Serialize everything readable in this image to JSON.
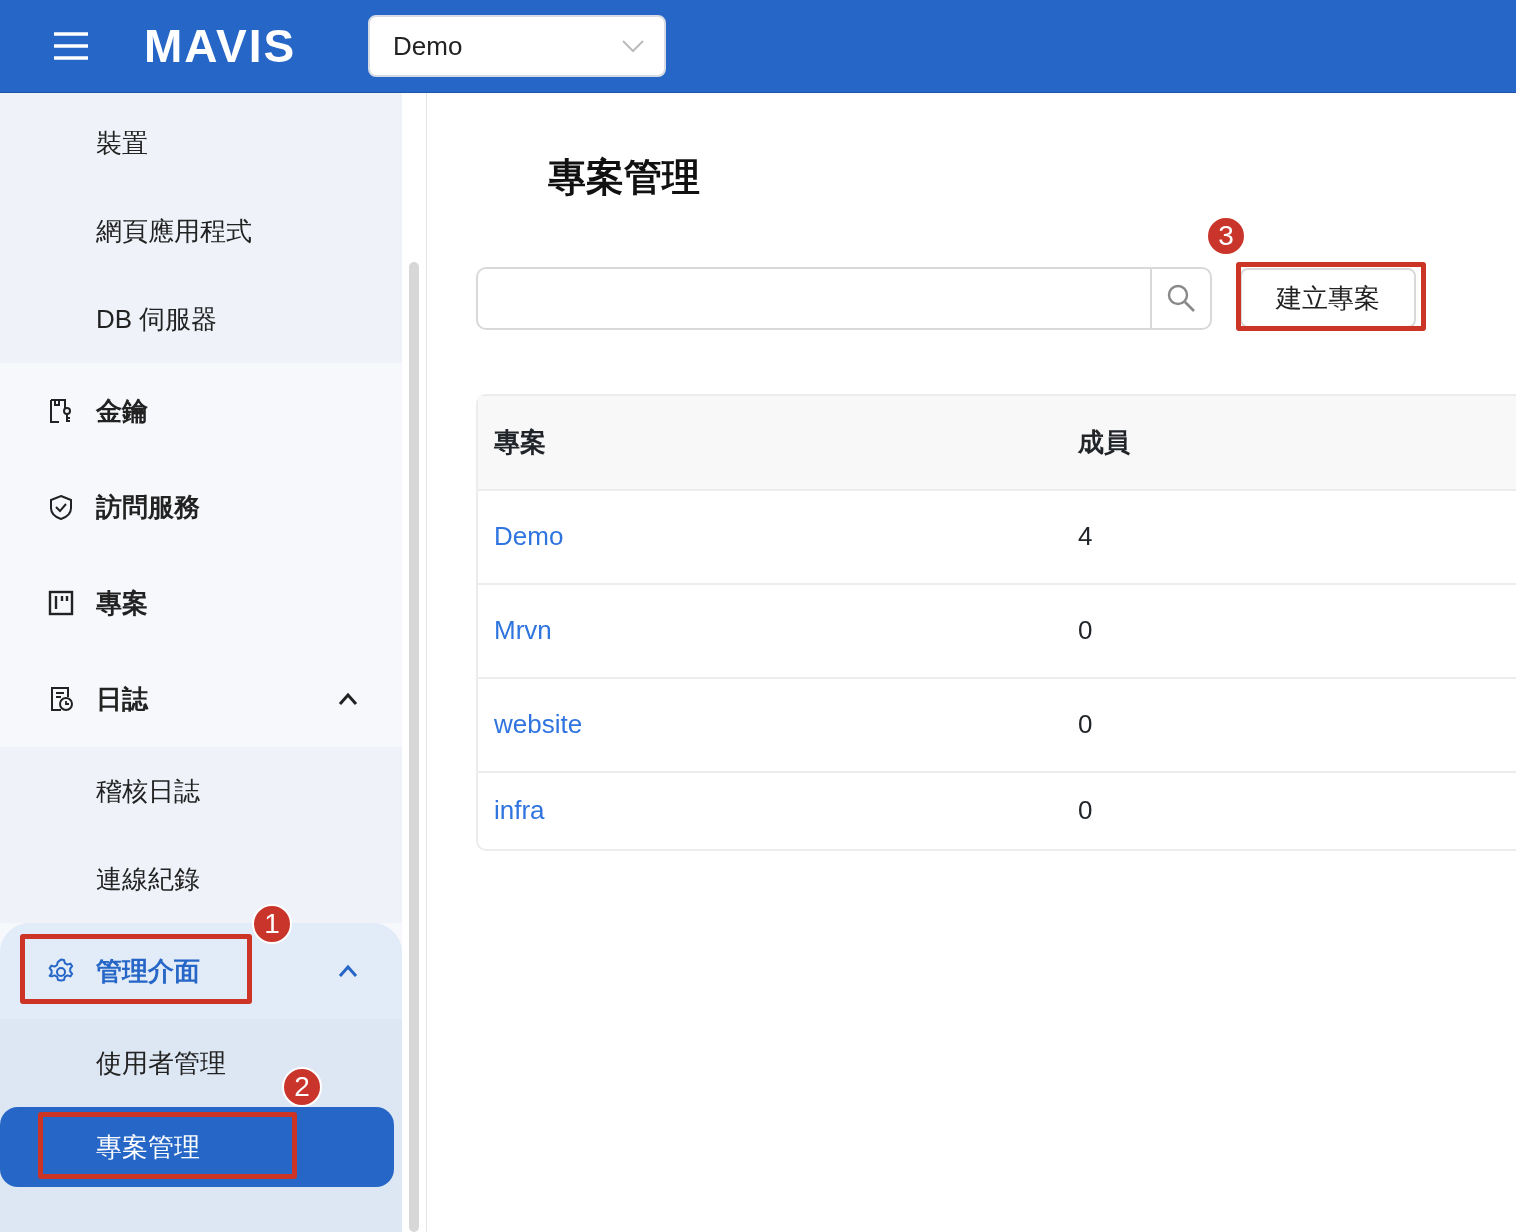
{
  "topbar": {
    "logo": "MAVIS",
    "project_select": {
      "value": "Demo"
    }
  },
  "sidebar": {
    "top_children": [
      {
        "label": "裝置",
        "selected": false
      },
      {
        "label": "網頁應用程式",
        "selected": false
      },
      {
        "label": "DB 伺服器",
        "selected": false
      }
    ],
    "items": [
      {
        "label": "金鑰",
        "kind": "key",
        "active": false
      },
      {
        "label": "訪問服務",
        "kind": "shield",
        "active": false
      },
      {
        "label": "專案",
        "kind": "board",
        "active": false
      },
      {
        "label": "日誌",
        "kind": "log",
        "active": false,
        "expanded": true,
        "children": [
          {
            "label": "稽核日誌",
            "selected": false
          },
          {
            "label": "連線紀錄",
            "selected": false
          }
        ]
      },
      {
        "label": "管理介面",
        "kind": "gear",
        "active": true,
        "expanded": true,
        "callout": "1",
        "children": [
          {
            "label": "使用者管理",
            "selected": false
          },
          {
            "label": "專案管理",
            "selected": true,
            "callout": "2"
          }
        ]
      }
    ]
  },
  "main": {
    "title": "專案管理",
    "create_button": {
      "label": "建立專案",
      "callout": "3"
    },
    "table": {
      "columns": [
        "專案",
        "成員"
      ],
      "rows": [
        [
          "Demo",
          "4"
        ],
        [
          "Mrvn",
          "0"
        ],
        [
          "website",
          "0"
        ],
        [
          "infra",
          "0"
        ]
      ]
    }
  }
}
